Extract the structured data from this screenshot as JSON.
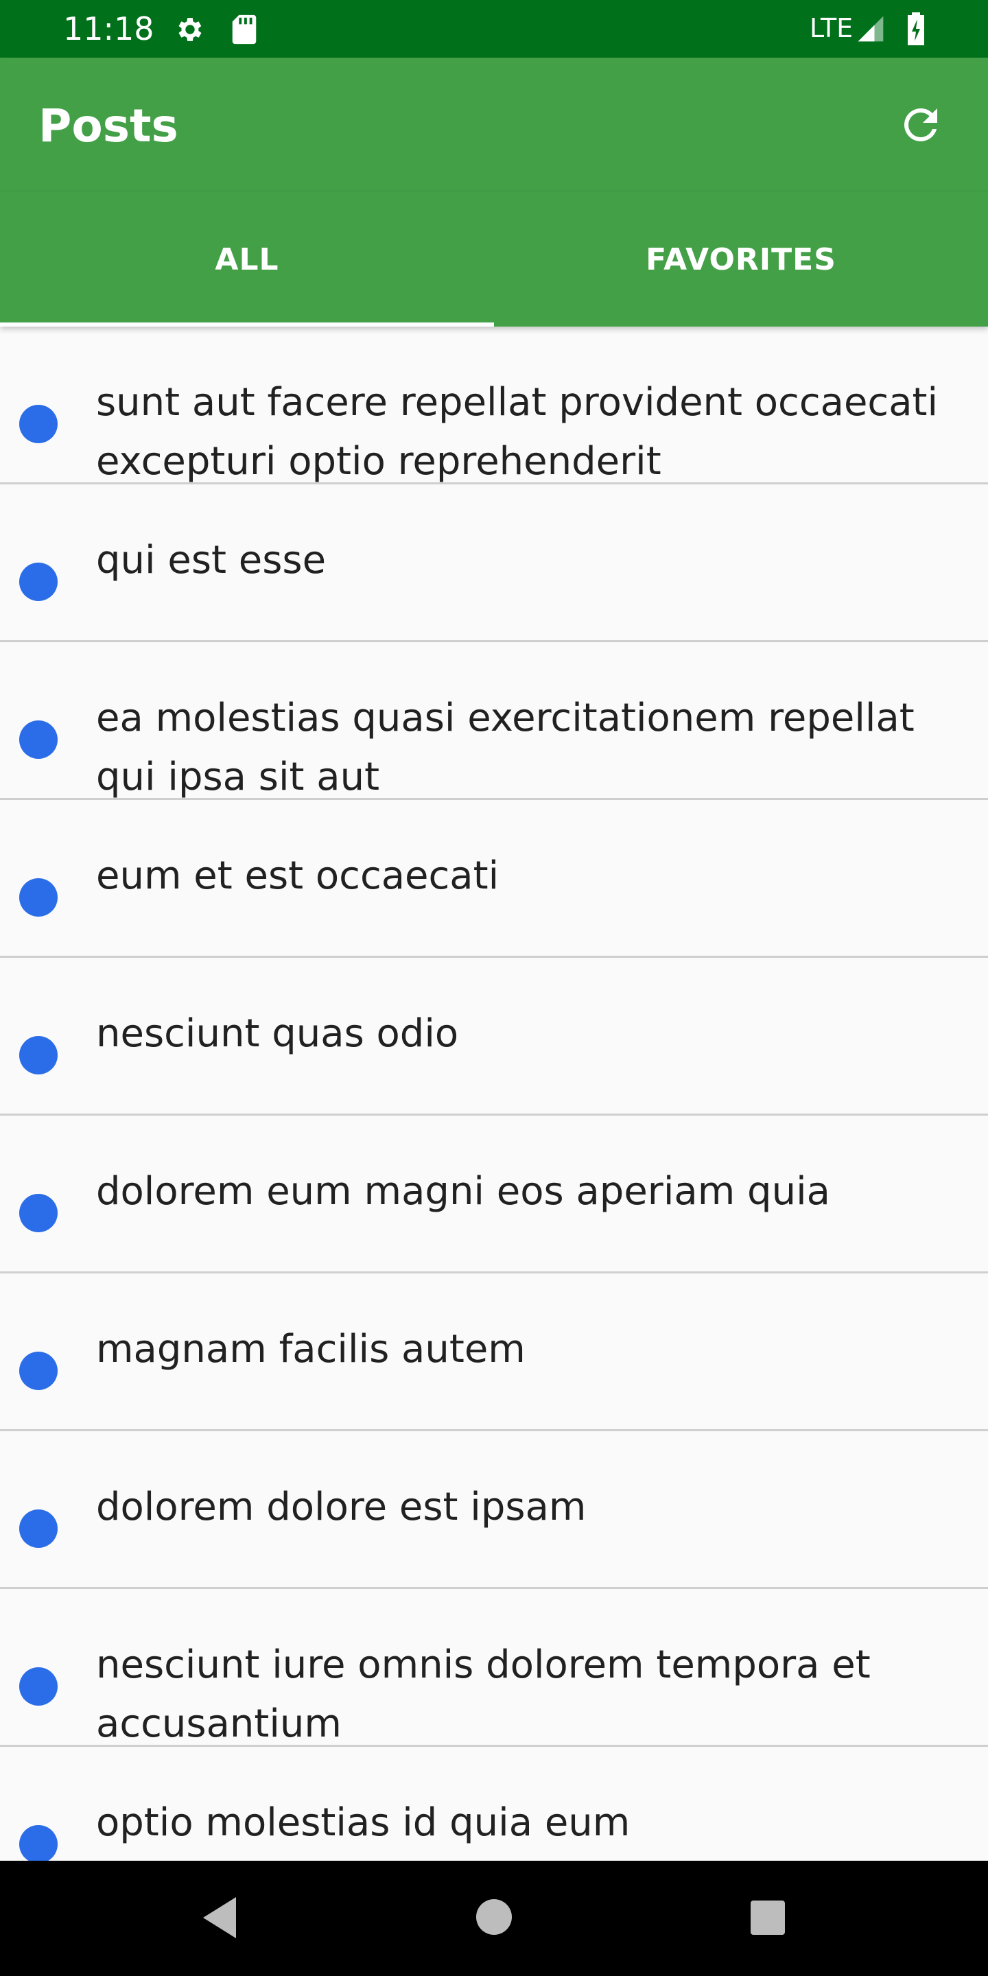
{
  "status_bar": {
    "time": "11:18",
    "network": "LTE",
    "icons": [
      "gear-icon",
      "sd-card-icon",
      "signal-icon",
      "battery-charging-icon"
    ]
  },
  "app_bar": {
    "title": "Posts",
    "refresh_icon": "refresh-icon",
    "color": "#43a047"
  },
  "tabs": [
    {
      "label": "ALL",
      "selected": true
    },
    {
      "label": "FAVORITES",
      "selected": false
    }
  ],
  "posts": [
    {
      "title": "sunt aut facere repellat provident occaecati excepturi optio reprehenderit"
    },
    {
      "title": "qui est esse"
    },
    {
      "title": "ea molestias quasi exercitationem repellat qui ipsa sit aut"
    },
    {
      "title": "eum et est occaecati"
    },
    {
      "title": "nesciunt quas odio"
    },
    {
      "title": "dolorem eum magni eos aperiam quia"
    },
    {
      "title": "magnam facilis autem"
    },
    {
      "title": "dolorem dolore est ipsam"
    },
    {
      "title": "nesciunt iure omnis dolorem tempora et accusantium"
    },
    {
      "title": "optio molestias id quia eum"
    }
  ],
  "colors": {
    "status_bar": "#00701a",
    "dot": "#2b6de8",
    "divider": "#cfcfcf"
  },
  "nav_bar": {
    "icons": [
      "back-icon",
      "home-icon",
      "recents-icon"
    ]
  }
}
